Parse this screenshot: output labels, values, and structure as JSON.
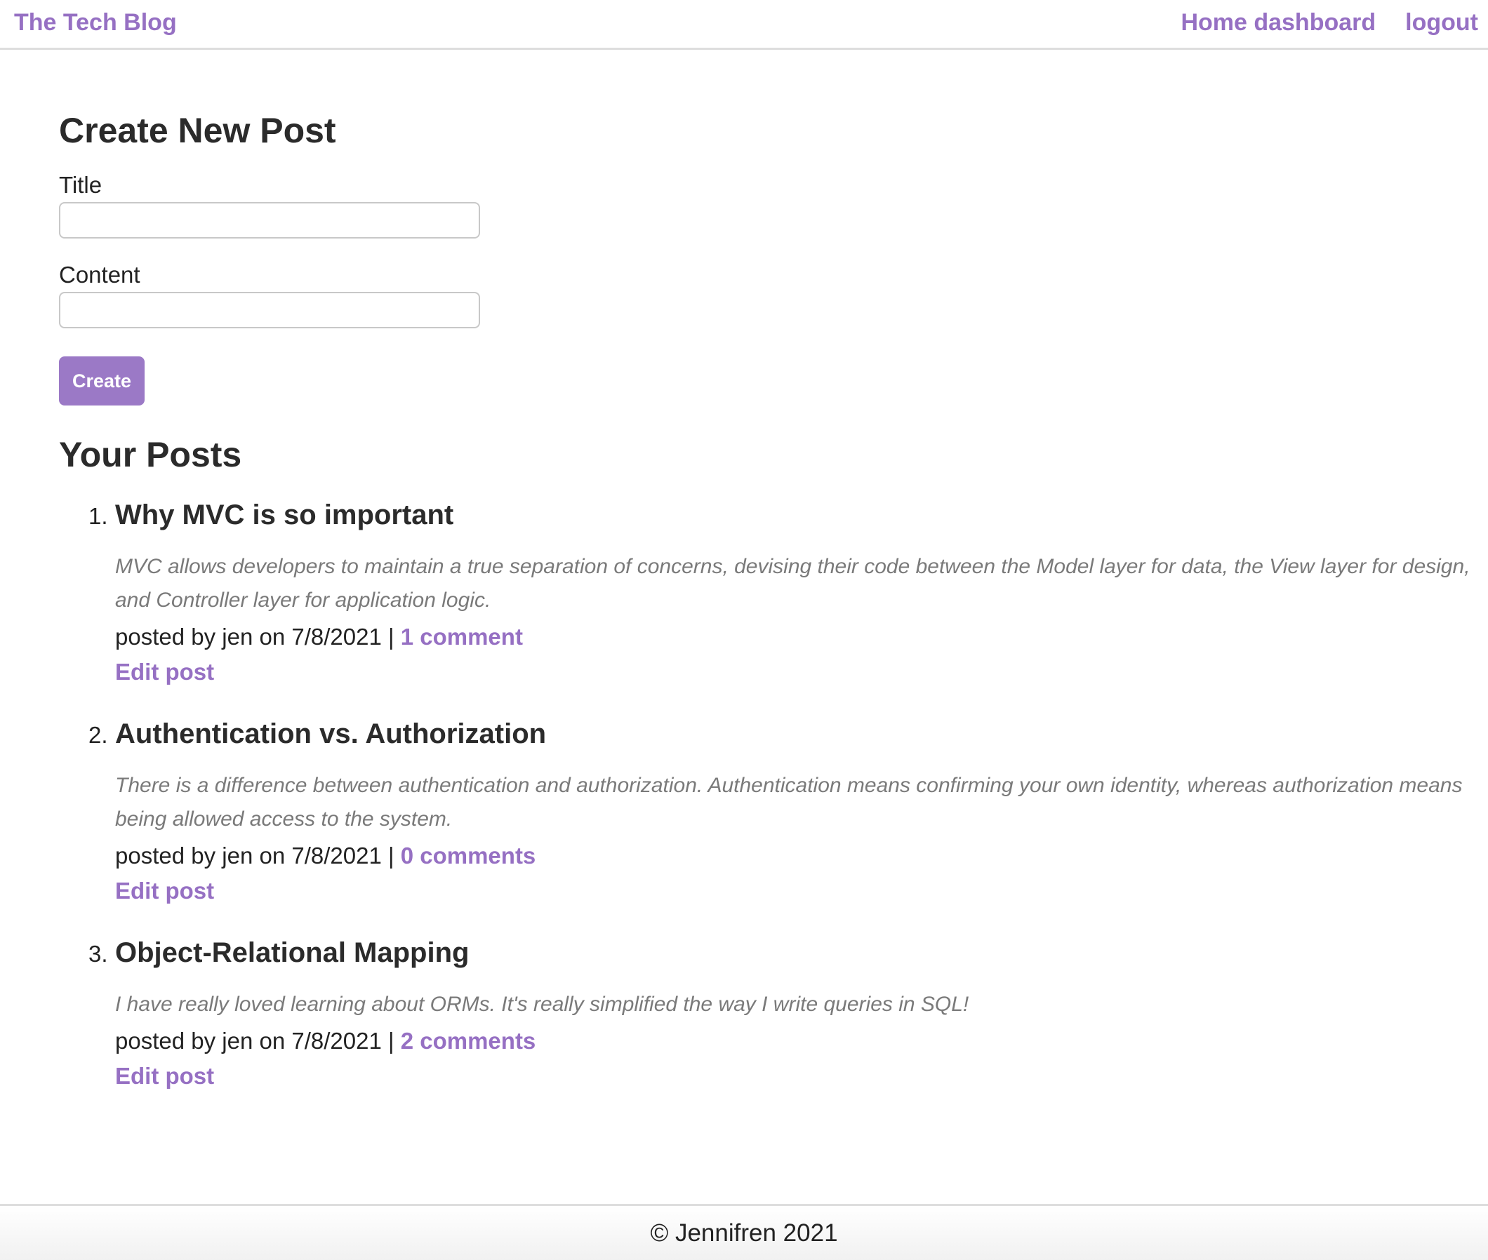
{
  "header": {
    "brand": "The Tech Blog",
    "nav": [
      {
        "label": "Home dashboard"
      },
      {
        "label": "logout"
      }
    ]
  },
  "create_form": {
    "heading": "Create New Post",
    "title_label": "Title",
    "title_value": "",
    "content_label": "Content",
    "content_value": "",
    "submit_label": "Create"
  },
  "posts_section": {
    "heading": "Your Posts",
    "posts": [
      {
        "number": "1.",
        "title": "Why MVC is so important",
        "body": "MVC allows developers to maintain a true separation of concerns, devising their code between the Model layer for data, the View layer for design, and Controller layer for application logic.",
        "meta_prefix": "posted by jen on 7/8/2021 | ",
        "comments": "1 comment",
        "edit": "Edit post"
      },
      {
        "number": "2.",
        "title": "Authentication vs. Authorization",
        "body": "There is a difference between authentication and authorization. Authentication means confirming your own identity, whereas authorization means being allowed access to the system.",
        "meta_prefix": "posted by jen on 7/8/2021 | ",
        "comments": "0 comments",
        "edit": "Edit post"
      },
      {
        "number": "3.",
        "title": "Object-Relational Mapping",
        "body": "I have really loved learning about ORMs. It's really simplified the way I write queries in SQL!",
        "meta_prefix": "posted by jen on 7/8/2021 | ",
        "comments": "2 comments",
        "edit": "Edit post"
      }
    ]
  },
  "footer": {
    "text": "© Jennifren 2021"
  },
  "colors": {
    "accent": "#9670c3",
    "button": "#9b79c6",
    "muted_text": "#7a7a7a"
  }
}
